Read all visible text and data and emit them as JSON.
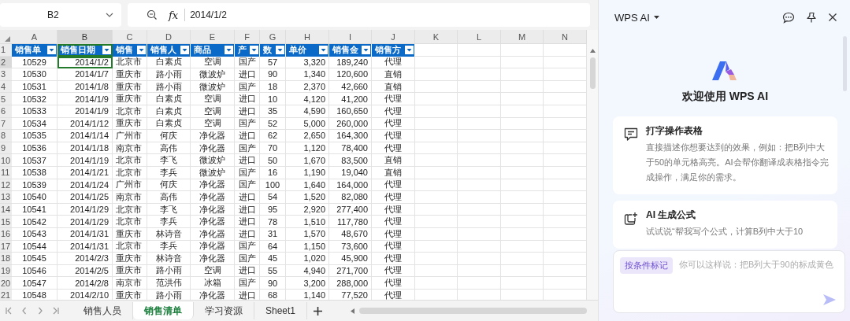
{
  "formula_bar": {
    "name_box": "B2",
    "function_label": "fx",
    "value": "2014/1/2"
  },
  "columns": [
    {
      "label": "A",
      "selected": false
    },
    {
      "label": "B",
      "selected": true
    },
    {
      "label": "C",
      "selected": false
    },
    {
      "label": "D",
      "selected": false
    },
    {
      "label": "E",
      "selected": false
    },
    {
      "label": "F",
      "selected": false
    },
    {
      "label": "G",
      "selected": false
    },
    {
      "label": "H",
      "selected": false
    },
    {
      "label": "I",
      "selected": false
    },
    {
      "label": "J",
      "selected": false
    },
    {
      "label": "K",
      "selected": false
    },
    {
      "label": "L",
      "selected": false
    },
    {
      "label": "M",
      "selected": false
    },
    {
      "label": "N",
      "selected": false
    }
  ],
  "header_row": {
    "number": "1",
    "cells": [
      "销售单",
      "销售日期",
      "销售",
      "销售人",
      "商品",
      "产",
      "数",
      "单价",
      "销售金",
      "销售方"
    ]
  },
  "rows": [
    {
      "number": "2",
      "selected": true,
      "cells": [
        "10529",
        "2014/1/2",
        "北京市",
        "白素贞",
        "空调",
        "国产",
        "57",
        "3,320",
        "189,240",
        "代理"
      ]
    },
    {
      "number": "3",
      "selected": false,
      "cells": [
        "10530",
        "2014/1/7",
        "重庆市",
        "路小雨",
        "微波炉",
        "进口",
        "90",
        "1,340",
        "120,600",
        "直销"
      ]
    },
    {
      "number": "4",
      "selected": false,
      "cells": [
        "10531",
        "2014/1/8",
        "重庆市",
        "路小雨",
        "微波炉",
        "国产",
        "18",
        "2,370",
        "42,660",
        "直销"
      ]
    },
    {
      "number": "5",
      "selected": false,
      "cells": [
        "10532",
        "2014/1/9",
        "重庆市",
        "白素贞",
        "空调",
        "进口",
        "10",
        "4,120",
        "41,200",
        "代理"
      ]
    },
    {
      "number": "6",
      "selected": false,
      "cells": [
        "10533",
        "2014/1/9",
        "北京市",
        "白素贞",
        "空调",
        "进口",
        "35",
        "4,590",
        "160,650",
        "代理"
      ]
    },
    {
      "number": "7",
      "selected": false,
      "cells": [
        "10534",
        "2014/1/12",
        "重庆市",
        "白素贞",
        "空调",
        "国产",
        "52",
        "5,000",
        "260,000",
        "代理"
      ]
    },
    {
      "number": "8",
      "selected": false,
      "cells": [
        "10535",
        "2014/1/14",
        "广州市",
        "何庆",
        "净化器",
        "进口",
        "62",
        "2,650",
        "164,300",
        "代理"
      ]
    },
    {
      "number": "9",
      "selected": false,
      "cells": [
        "10536",
        "2014/1/18",
        "南京市",
        "高伟",
        "净化器",
        "国产",
        "70",
        "1,120",
        "78,400",
        "代理"
      ]
    },
    {
      "number": "10",
      "selected": false,
      "cells": [
        "10537",
        "2014/1/19",
        "北京市",
        "李飞",
        "微波炉",
        "进口",
        "50",
        "1,670",
        "83,500",
        "直销"
      ]
    },
    {
      "number": "11",
      "selected": false,
      "cells": [
        "10538",
        "2014/1/21",
        "北京市",
        "李兵",
        "微波炉",
        "国产",
        "16",
        "1,190",
        "19,040",
        "直销"
      ]
    },
    {
      "number": "12",
      "selected": false,
      "cells": [
        "10539",
        "2014/1/24",
        "广州市",
        "何庆",
        "净化器",
        "国产",
        "100",
        "1,640",
        "164,000",
        "代理"
      ]
    },
    {
      "number": "13",
      "selected": false,
      "cells": [
        "10540",
        "2014/1/25",
        "南京市",
        "高伟",
        "净化器",
        "进口",
        "54",
        "1,520",
        "82,080",
        "代理"
      ]
    },
    {
      "number": "14",
      "selected": false,
      "cells": [
        "10541",
        "2014/1/29",
        "北京市",
        "李飞",
        "净化器",
        "进口",
        "95",
        "2,920",
        "277,400",
        "代理"
      ]
    },
    {
      "number": "15",
      "selected": false,
      "cells": [
        "10542",
        "2014/1/29",
        "北京市",
        "李兵",
        "净化器",
        "进口",
        "78",
        "1,510",
        "117,780",
        "代理"
      ]
    },
    {
      "number": "16",
      "selected": false,
      "cells": [
        "10543",
        "2014/1/31",
        "重庆市",
        "林诗音",
        "净化器",
        "进口",
        "31",
        "1,570",
        "48,670",
        "代理"
      ]
    },
    {
      "number": "17",
      "selected": false,
      "cells": [
        "10544",
        "2014/1/31",
        "北京市",
        "李兵",
        "净化器",
        "国产",
        "64",
        "1,150",
        "73,600",
        "代理"
      ]
    },
    {
      "number": "18",
      "selected": false,
      "cells": [
        "10545",
        "2014/2/3",
        "重庆市",
        "林诗音",
        "净化器",
        "国产",
        "45",
        "1,020",
        "45,900",
        "代理"
      ]
    },
    {
      "number": "19",
      "selected": false,
      "cells": [
        "10546",
        "2014/2/5",
        "重庆市",
        "路小雨",
        "空调",
        "进口",
        "55",
        "4,940",
        "271,700",
        "代理"
      ]
    },
    {
      "number": "20",
      "selected": false,
      "cells": [
        "10547",
        "2014/2/8",
        "南京市",
        "范洪伟",
        "冰箱",
        "国产",
        "90",
        "3,200",
        "288,000",
        "代理"
      ]
    },
    {
      "number": "21",
      "selected": false,
      "cells": [
        "10548",
        "2014/2/10",
        "重庆市",
        "路小雨",
        "净化器",
        "进口",
        "68",
        "1,140",
        "77,520",
        "代理"
      ]
    }
  ],
  "sheet_tabs": [
    {
      "label": "销售人员",
      "selected": false
    },
    {
      "label": "销售清单",
      "selected": true
    },
    {
      "label": "学习资源",
      "selected": false
    },
    {
      "label": "Sheet1",
      "selected": false
    }
  ],
  "ai_panel": {
    "title": "WPS AI",
    "welcome": "欢迎使用 WPS AI",
    "cards": [
      {
        "kind": "chat",
        "title": "打字操作表格",
        "text": "直接描述你想要达到的效果，例如：把B列中大于50的单元格高亮。AI会帮你翻译成表格指令完成操作，满足你的需求。"
      },
      {
        "kind": "formula",
        "title": "AI 生成公式",
        "text": "试试说“帮我写个公式，计算B列中大于10"
      }
    ],
    "input": {
      "chip": "按条件标记",
      "placeholder": "你可以这样说：把B列大于90的标成黄色"
    }
  }
}
